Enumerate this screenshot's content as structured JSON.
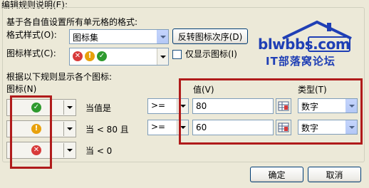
{
  "dialog": {
    "section_title": "编辑规则说明(E):",
    "subtitle": "基于各自值设置所有单元格的格式:"
  },
  "format_style": {
    "label": "格式样式(O):",
    "value": "图标集"
  },
  "reverse_button": "反转图标次序(D)",
  "icon_style": {
    "label": "图标样式(C):",
    "icons": [
      "red-x-icon",
      "yellow-exclamation-icon",
      "green-check-icon"
    ]
  },
  "show_icon_only": {
    "label": "仅显示图标(I)",
    "checked": false
  },
  "rules_title": "根据以下规则显示各个图标:",
  "icon_header": "图标(N)",
  "value_header": "值(V)",
  "type_header": "类型(T)",
  "rules": [
    {
      "icon": "green-check-icon",
      "condition_text": "当值是",
      "operator": ">=",
      "value": "80",
      "type": "数字"
    },
    {
      "icon": "yellow-exclamation-icon",
      "condition_text": "当 < 80 且",
      "operator": ">=",
      "value": "60",
      "type": "数字"
    },
    {
      "icon": "red-x-icon",
      "condition_text": "当 < 0"
    }
  ],
  "ok_button": "确定",
  "cancel_button": "取消",
  "watermark": {
    "url": "blwbbs.com",
    "name": "IT部落窝论坛"
  },
  "colors": {
    "dialog_bg": "#ece9d8",
    "highlight_box": "#b01b1b",
    "icon_green": "#2e9a2e",
    "icon_yellow": "#e8a10c",
    "icon_red": "#d83a3a",
    "watermark_blue": "#1f3fb5"
  }
}
